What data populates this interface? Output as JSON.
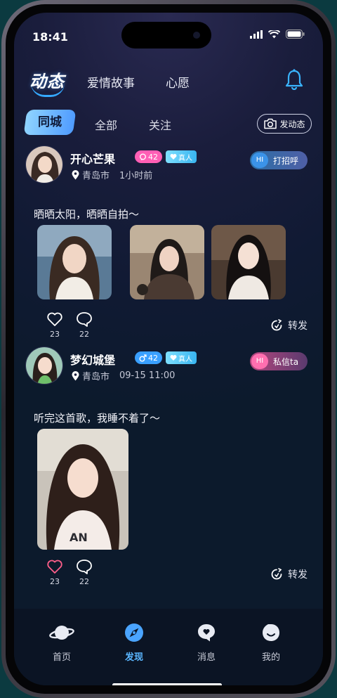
{
  "status_bar": {
    "time": "18:41"
  },
  "header": {
    "logo_text": "动态",
    "tabs": [
      {
        "label": "爱情故事"
      },
      {
        "label": "心愿"
      }
    ]
  },
  "filters": {
    "active": "同城",
    "tabs": [
      {
        "label": "全部"
      },
      {
        "label": "关注"
      }
    ],
    "post_label": "发动态"
  },
  "feed": [
    {
      "name": "开心芒果",
      "gender": "female",
      "gender_color": "#ff5fb5",
      "age": "42",
      "verified_label": "真人",
      "location": "青岛市",
      "time": "1小时前",
      "cta_icon": "HI",
      "cta_label": "打招呼",
      "text": "晒晒太阳，晒晒自拍～",
      "photo_count": 3,
      "likes": "23",
      "liked": false,
      "comments": "22",
      "repost_label": "转发"
    },
    {
      "name": "梦幻城堡",
      "gender": "male",
      "gender_color": "#3aa0ff",
      "age": "42",
      "verified_label": "真人",
      "location": "青岛市",
      "time": "09-15 11:00",
      "cta_icon": "HI",
      "cta_label": "私信ta",
      "text": "听完这首歌，我睡不着了～",
      "photo_count": 1,
      "likes": "23",
      "liked": true,
      "comments": "22",
      "repost_label": "转发"
    }
  ],
  "tabbar": {
    "items": [
      {
        "label": "首页"
      },
      {
        "label": "发现"
      },
      {
        "label": "消息"
      },
      {
        "label": "我的"
      }
    ],
    "active": "发现"
  },
  "colors": {
    "accent": "#4f9bff",
    "like_active": "#ff5f8a"
  }
}
